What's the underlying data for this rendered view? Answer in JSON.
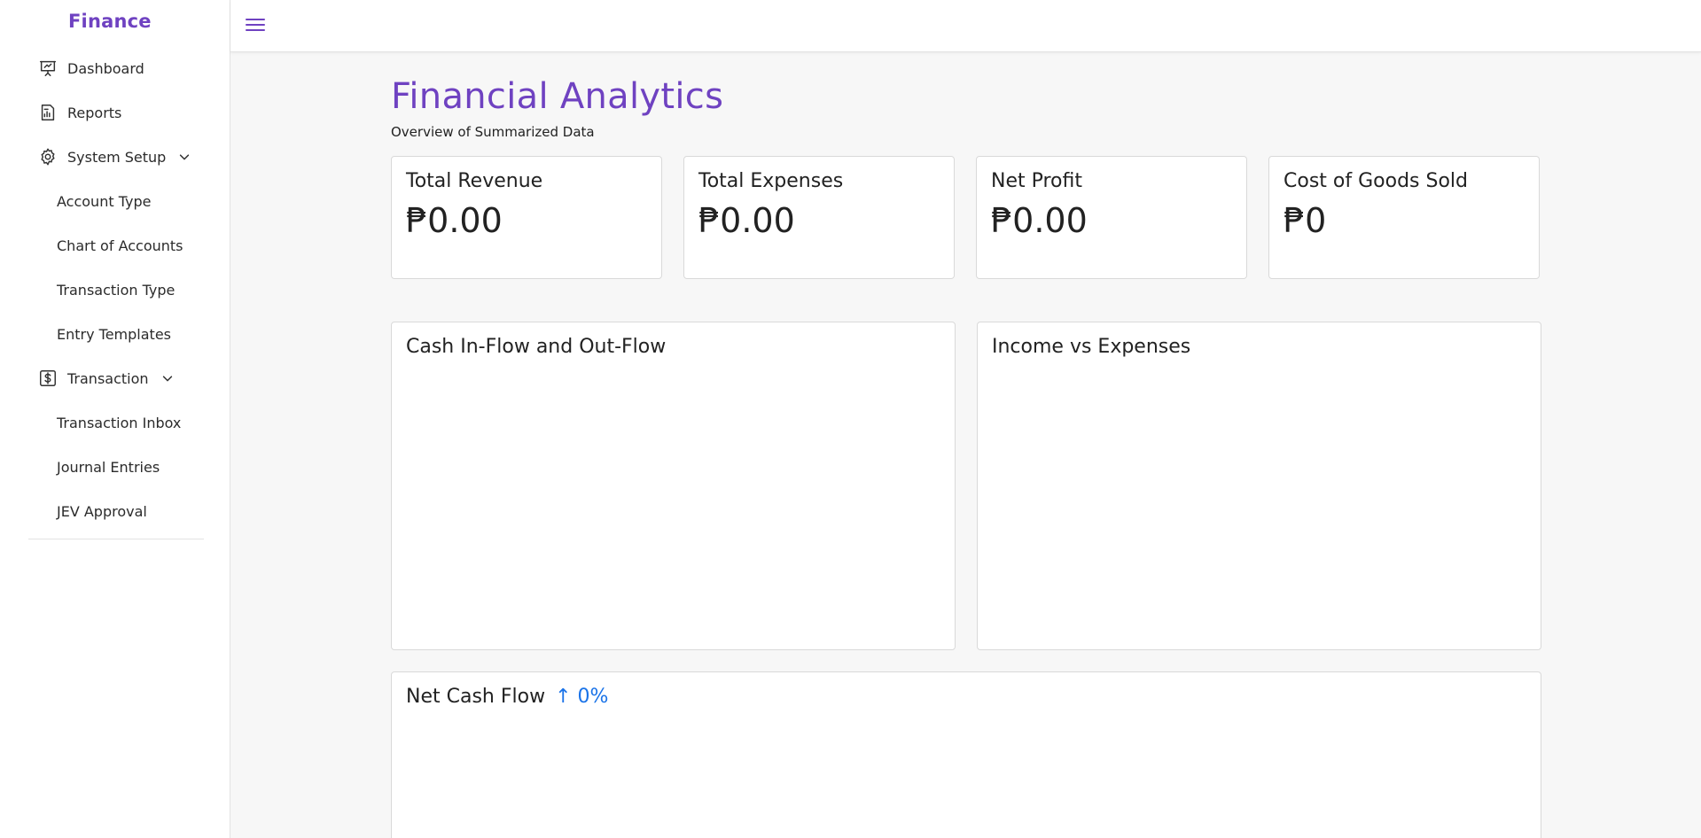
{
  "brand": "Finance",
  "sidebar": {
    "items": [
      {
        "label": "Dashboard",
        "icon": "presentation-icon"
      },
      {
        "label": "Reports",
        "icon": "reports-icon"
      },
      {
        "label": "System Setup",
        "icon": "gear-icon",
        "expanded": true,
        "children": [
          "Account Type",
          "Chart of Accounts",
          "Transaction Type",
          "Entry Templates"
        ]
      },
      {
        "label": "Transaction",
        "icon": "dollar-icon",
        "expanded": true,
        "children": [
          "Transaction Inbox",
          "Journal Entries",
          "JEV Approval"
        ]
      }
    ]
  },
  "header": {
    "menu_icon": "hamburger-icon"
  },
  "page": {
    "title": "Financial Analytics",
    "subtitle": "Overview of Summarized Data"
  },
  "stats": [
    {
      "label": "Total Revenue",
      "value": "₱0.00"
    },
    {
      "label": "Total Expenses",
      "value": "₱0.00"
    },
    {
      "label": "Net Profit",
      "value": "₱0.00"
    },
    {
      "label": "Cost of Goods Sold",
      "value": "₱0"
    }
  ],
  "charts": {
    "cash_flow_title": "Cash In-Flow and Out-Flow",
    "income_expenses_title": "Income vs Expenses",
    "net_cash_flow_title": "Net Cash Flow",
    "net_cash_flow_trend": "↑ 0%"
  },
  "colors": {
    "accent": "#6f42c1",
    "trend": "#1a73e8"
  }
}
